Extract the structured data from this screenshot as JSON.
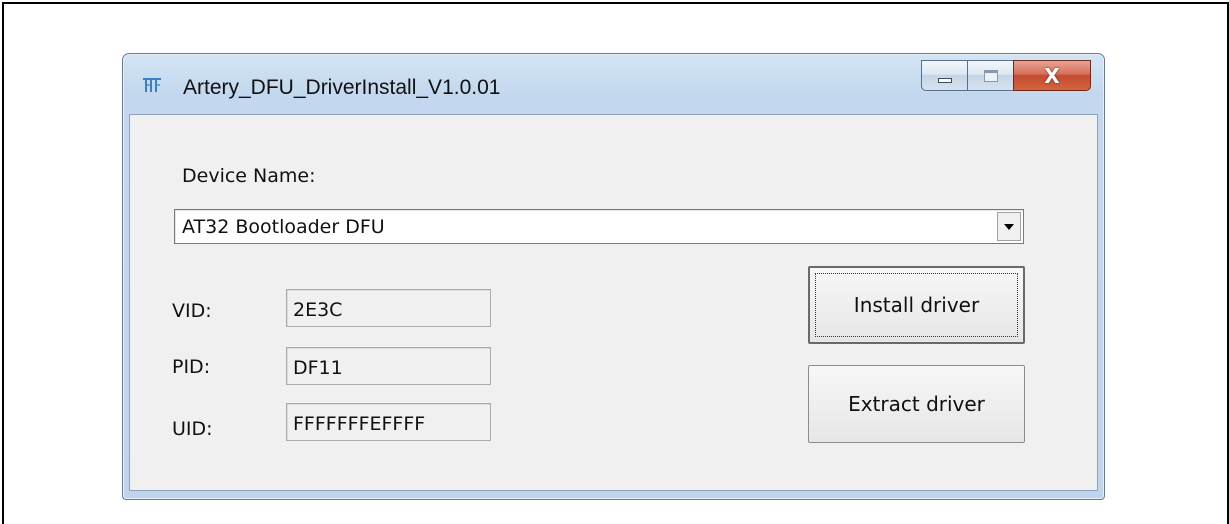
{
  "window": {
    "title": "Artery_DFU_DriverInstall_V1.0.01",
    "buttons": {
      "minimize_icon": "minimize-icon",
      "maximize_icon": "maximize-icon",
      "close_glyph": "X"
    }
  },
  "form": {
    "device_label": "Device Name:",
    "device_selected": "AT32 Bootloader DFU",
    "vid_label": "VID:",
    "vid_value": "2E3C",
    "pid_label": "PID:",
    "pid_value": "DF11",
    "uid_label": "UID:",
    "uid_value": "FFFFFFFEFFFF"
  },
  "actions": {
    "install_label": "Install driver",
    "extract_label": "Extract driver"
  },
  "colors": {
    "close_button": "#c44a2f",
    "frame": "#bfd5ec",
    "client_bg": "#f0f0f0"
  }
}
